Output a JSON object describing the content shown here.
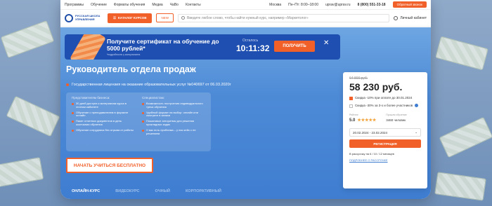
{
  "topbar": {
    "menu": [
      "Программы",
      "Обучение",
      "Форматы обучения",
      "Медиа",
      "ЧаВо",
      "Контакты"
    ],
    "city": "Москва",
    "hours": "Пн–Пт: 8:00–18:00",
    "email": "uprav@uprav.ru",
    "phone": "8 (800) 551-33-18",
    "callback": "Обратный звонок"
  },
  "header": {
    "logo_text": "РУССКАЯ ШКОЛА УПРАВЛЕНИЯ",
    "catalog": "КАТАЛОГ КУРСОВ",
    "new": "NEW",
    "search_placeholder": "Введите любое слово, чтобы найти нужный курс, например «Маркетолог»",
    "account": "Личный кабинет"
  },
  "promo": {
    "title": "Получите сертификат на обучение до 5000 рублей*",
    "note": "*подробности у консультанта",
    "timer_label": "Осталось",
    "timer": "10:11:32",
    "button": "ПОЛУЧИТЬ"
  },
  "course": {
    "title": "Руководитель отдела продаж",
    "license": "Государственная лицензия на оказание образовательных услуг №040697 от 06.03.2020г",
    "cta": "НАЧАТЬ УЧИТЬСЯ БЕСПЛАТНО"
  },
  "benefits": {
    "col1_title": "Представителям бизнеса:",
    "col1": [
      "30 дней доступа к материалам курса в личном кабинете",
      "Обучение с преподавателем в формате онлайн",
      "Пакет отчетных документов в день окончания обучения",
      "Обучение сотрудника без отрыва от работы"
    ],
    "col2_title": "Специалистам:",
    "col2": [
      "Возможность построения индивидуального трека обучения",
      "Удобный формат на выбор: онлайн или смотрите в записи",
      "Пошаговые алгоритмы для решения прикладных задач",
      "У вас есть проблема – у нас кейс с ее решением"
    ]
  },
  "tabs": [
    "ОНЛАЙН-КУРС",
    "ВИДЕОКУРС",
    "ОЧНЫЙ",
    "КОРПОРАТИВНЫЙ"
  ],
  "price": {
    "old": "64 800 руб.",
    "new": "58 230 руб.",
    "discount1": "Скидка -10% при оплате до 30.01.2024",
    "discount2": "Скидка -30% за 3-х и более участников",
    "rating_label": "Рейтинг",
    "rating": "5.0",
    "students_label": "Прошли обучение",
    "students": "3460 человек",
    "dates": "20.02.2024 - 23.02.2024",
    "register": "РЕГИСТРАЦИЯ",
    "installment": "В рассрочку на 6 / 10 / 12 месяцев",
    "more": "ПОДРОБНЕЕ О РАССРОЧКЕ"
  },
  "colors": {
    "accent": "#f2602a",
    "brand": "#1f4fb0",
    "hero": "#4d8ad6"
  }
}
